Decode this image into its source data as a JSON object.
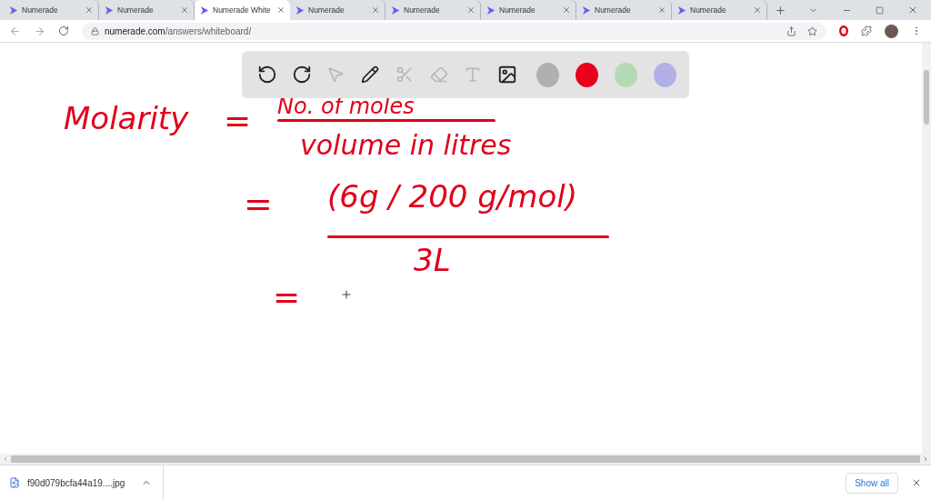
{
  "tabs": [
    {
      "title": "Numerade",
      "selected": false
    },
    {
      "title": "Numerade",
      "selected": false
    },
    {
      "title": "Numerade White",
      "selected": true
    },
    {
      "title": "Numerade",
      "selected": false
    },
    {
      "title": "Numerade",
      "selected": false
    },
    {
      "title": "Numerade",
      "selected": false
    },
    {
      "title": "Numerade",
      "selected": false
    },
    {
      "title": "Numerade",
      "selected": false
    }
  ],
  "address": {
    "domain": "numerade.com",
    "path": "/answers/whiteboard/"
  },
  "toolbar": {
    "tools": [
      {
        "kind": "undo",
        "disabled": false
      },
      {
        "kind": "redo",
        "disabled": false
      },
      {
        "kind": "select",
        "disabled": true
      },
      {
        "kind": "pen",
        "disabled": false
      },
      {
        "kind": "scissors",
        "disabled": true
      },
      {
        "kind": "eraser",
        "disabled": true
      },
      {
        "kind": "text",
        "disabled": true
      },
      {
        "kind": "image",
        "disabled": false
      }
    ],
    "colors": [
      {
        "color": "#b0b0b0"
      },
      {
        "color": "#e8001c"
      },
      {
        "color": "#b5d8b5"
      },
      {
        "color": "#b3b0e6"
      }
    ]
  },
  "board": {
    "strokes": [
      {
        "kind": "text",
        "text": "Molarity"
      },
      {
        "kind": "text",
        "text": "="
      },
      {
        "kind": "text",
        "text": "No. of moles"
      },
      {
        "kind": "bar"
      },
      {
        "kind": "text",
        "text": "volume in litres"
      },
      {
        "kind": "text",
        "text": "="
      },
      {
        "kind": "text",
        "text": "(6g / 200 g/mol)"
      },
      {
        "kind": "bar"
      },
      {
        "kind": "text",
        "text": "3L"
      },
      {
        "kind": "text",
        "text": "="
      },
      {
        "kind": "cursor"
      }
    ]
  },
  "download": {
    "file": "f90d079bcfa44a19....jpg",
    "show_all": "Show all"
  }
}
